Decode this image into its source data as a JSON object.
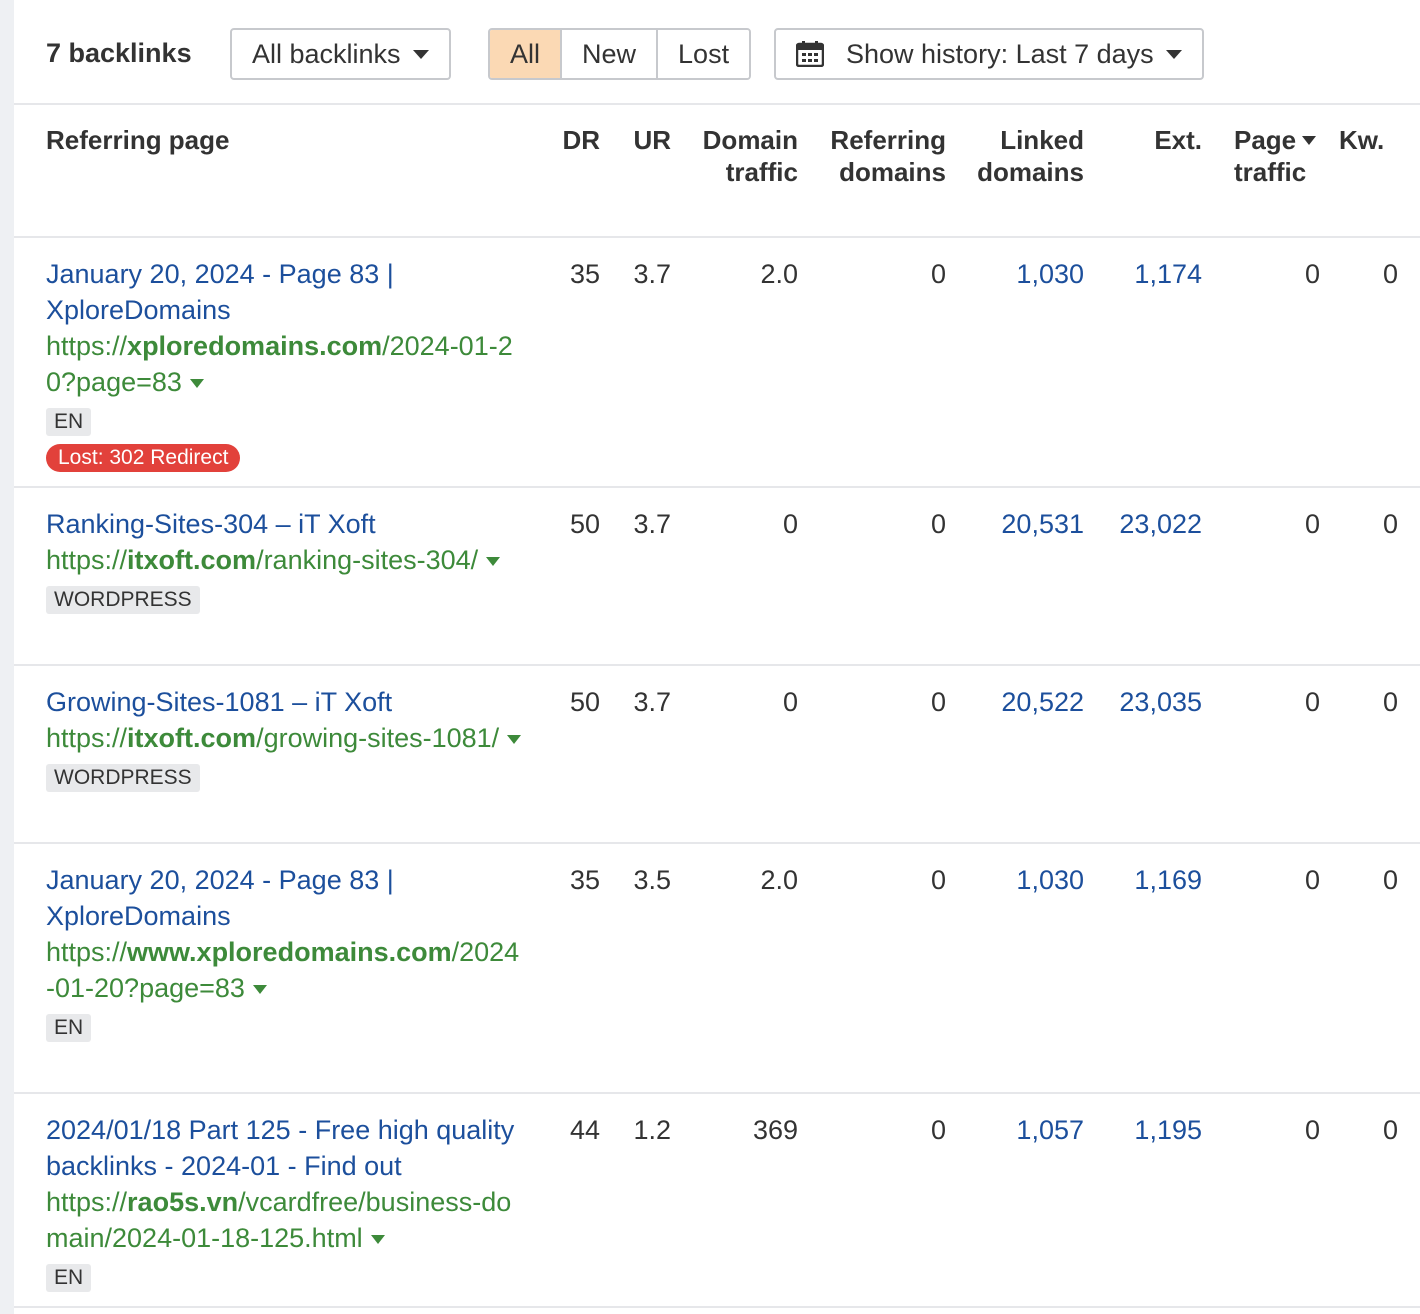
{
  "toolbar": {
    "count_title": "7 backlinks",
    "filter_dropdown": "All backlinks",
    "segments": [
      "All",
      "New",
      "Lost"
    ],
    "active_segment": "All",
    "history_dropdown": "Show history: Last 7 days",
    "accent_color": "#fbd9b4"
  },
  "columns": {
    "referring_page": "Referring page",
    "dr": "DR",
    "ur": "UR",
    "domain_traffic": [
      "Domain",
      "traffic"
    ],
    "referring_domains": [
      "Referring",
      "domains"
    ],
    "linked_domains": [
      "Linked",
      "domains"
    ],
    "ext": "Ext.",
    "page_traffic": [
      "Page",
      "traffic"
    ],
    "kw": "Kw."
  },
  "rows": [
    {
      "title": "January 20, 2024 - Page 83 | XploreDomains",
      "url_prefix": "https://",
      "url_domain": "xploredomains.com",
      "url_path": "/2024-01-20?page=83",
      "tag": "EN",
      "badge": "Lost: 302 Redirect",
      "dr": "35",
      "ur": "3.7",
      "domain_traffic": "2.0",
      "referring_domains": "0",
      "linked_domains": "1,030",
      "ext": "1,174",
      "page_traffic": "0",
      "kw": "0"
    },
    {
      "title": "Ranking-Sites-304 – iT Xoft",
      "url_prefix": "https://",
      "url_domain": "itxoft.com",
      "url_path": "/ranking-sites-304/",
      "tag": "WORDPRESS",
      "dr": "50",
      "ur": "3.7",
      "domain_traffic": "0",
      "referring_domains": "0",
      "linked_domains": "20,531",
      "ext": "23,022",
      "page_traffic": "0",
      "kw": "0"
    },
    {
      "title": "Growing-Sites-1081 – iT Xoft",
      "url_prefix": "https://",
      "url_domain": "itxoft.com",
      "url_path": "/growing-sites-1081/",
      "tag": "WORDPRESS",
      "dr": "50",
      "ur": "3.7",
      "domain_traffic": "0",
      "referring_domains": "0",
      "linked_domains": "20,522",
      "ext": "23,035",
      "page_traffic": "0",
      "kw": "0"
    },
    {
      "title": "January 20, 2024 - Page 83 | XploreDomains",
      "url_prefix": "https://",
      "url_domain": "www.xploredomains.com",
      "url_path": "/2024-01-20?page=83",
      "tag": "EN",
      "dr": "35",
      "ur": "3.5",
      "domain_traffic": "2.0",
      "referring_domains": "0",
      "linked_domains": "1,030",
      "ext": "1,169",
      "page_traffic": "0",
      "kw": "0"
    },
    {
      "title": "2024/01/18 Part 125 - Free high quality backlinks - 2024-01 - Find out",
      "url_prefix": "https://",
      "url_domain": "rao5s.vn",
      "url_path": "/vcardfree/business-domain/2024-01-18-125.html",
      "tag": "EN",
      "dr": "44",
      "ur": "1.2",
      "domain_traffic": "369",
      "referring_domains": "0",
      "linked_domains": "1,057",
      "ext": "1,195",
      "page_traffic": "0",
      "kw": "0"
    }
  ]
}
